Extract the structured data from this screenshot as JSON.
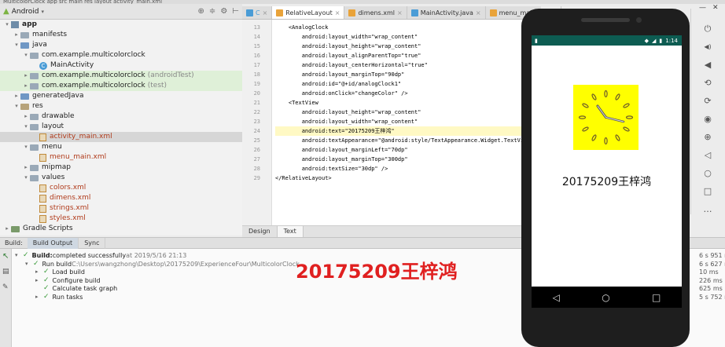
{
  "breadcrumb": "MulticolorClock  app  src  main  res  layout  activity_main.xml",
  "project": {
    "view_selector": "Android",
    "tree": [
      {
        "label": "app",
        "kind": "app",
        "arrow": "▾",
        "indent": 0
      },
      {
        "label": "manifests",
        "kind": "folder",
        "arrow": "▸",
        "indent": 1
      },
      {
        "label": "java",
        "kind": "folder-java",
        "arrow": "▾",
        "indent": 1
      },
      {
        "label": "com.example.multicolorclock",
        "kind": "folder",
        "arrow": "▾",
        "indent": 2
      },
      {
        "label": "MainActivity",
        "kind": "class",
        "arrow": "",
        "indent": 3
      },
      {
        "label": "com.example.multicolorclock",
        "sub": "(androidTest)",
        "kind": "folder",
        "arrow": "▸",
        "indent": 2,
        "highlight": true
      },
      {
        "label": "com.example.multicolorclock",
        "sub": "(test)",
        "kind": "folder",
        "arrow": "▸",
        "indent": 2,
        "highlight": true
      },
      {
        "label": "generatedJava",
        "kind": "folder-java",
        "arrow": "▸",
        "indent": 1
      },
      {
        "label": "res",
        "kind": "folder-res",
        "arrow": "▾",
        "indent": 1
      },
      {
        "label": "drawable",
        "kind": "folder",
        "arrow": "▸",
        "indent": 2
      },
      {
        "label": "layout",
        "kind": "folder",
        "arrow": "▾",
        "indent": 2
      },
      {
        "label": "activity_main.xml",
        "kind": "xml",
        "arrow": "",
        "indent": 3,
        "selected": true
      },
      {
        "label": "menu",
        "kind": "folder",
        "arrow": "▾",
        "indent": 2
      },
      {
        "label": "menu_main.xml",
        "kind": "xml",
        "arrow": "",
        "indent": 3
      },
      {
        "label": "mipmap",
        "kind": "folder",
        "arrow": "▸",
        "indent": 2
      },
      {
        "label": "values",
        "kind": "folder",
        "arrow": "▾",
        "indent": 2
      },
      {
        "label": "colors.xml",
        "kind": "xml",
        "arrow": "",
        "indent": 3
      },
      {
        "label": "dimens.xml",
        "kind": "xml",
        "arrow": "",
        "indent": 3
      },
      {
        "label": "strings.xml",
        "kind": "xml",
        "arrow": "",
        "indent": 3
      },
      {
        "label": "styles.xml",
        "kind": "xml",
        "arrow": "",
        "indent": 3
      },
      {
        "label": "Gradle Scripts",
        "kind": "gradle",
        "arrow": "▸",
        "indent": 0
      }
    ]
  },
  "editor": {
    "tabs": [
      {
        "label": "C",
        "kind": "class",
        "active": false
      },
      {
        "label": "RelativeLayout",
        "kind": "xml",
        "active": true
      },
      {
        "label": "dimens.xml",
        "kind": "xml",
        "active": false
      },
      {
        "label": "MainActivity.java",
        "kind": "class",
        "active": false
      },
      {
        "label": "menu_main.xml",
        "kind": "xml",
        "active": false
      }
    ],
    "lines": [
      {
        "n": "13",
        "text": "    <AnalogClock",
        "hl": false
      },
      {
        "n": "14",
        "text": "        android:layout_width=\"wrap_content\"",
        "hl": false
      },
      {
        "n": "15",
        "text": "        android:layout_height=\"wrap_content\"",
        "hl": false
      },
      {
        "n": "16",
        "text": "        android:layout_alignParentTop=\"true\"",
        "hl": false
      },
      {
        "n": "17",
        "text": "        android:layout_centerHorizontal=\"true\"",
        "hl": false
      },
      {
        "n": "18",
        "text": "        android:layout_marginTop=\"90dp\"",
        "hl": false
      },
      {
        "n": "19",
        "text": "        android:id=\"@+id/analogClock1\"",
        "hl": false
      },
      {
        "n": "20",
        "text": "        android:onClick=\"changeColor\" />",
        "hl": false
      },
      {
        "n": "21",
        "text": "    <TextView",
        "hl": false
      },
      {
        "n": "22",
        "text": "        android:layout_height=\"wrap_content\"",
        "hl": false
      },
      {
        "n": "23",
        "text": "        android:layout_width=\"wrap_content\"",
        "hl": false
      },
      {
        "n": "24",
        "text": "        android:text=\"20175209王梓鸿\"",
        "hl": true
      },
      {
        "n": "25",
        "text": "        android:textAppearance=\"@android:style/TextAppearance.Widget.TextView\"",
        "hl": false
      },
      {
        "n": "26",
        "text": "        android:layout_marginLeft=\"70dp\"",
        "hl": false
      },
      {
        "n": "27",
        "text": "        android:layout_marginTop=\"300dp\"",
        "hl": false
      },
      {
        "n": "28",
        "text": "        android:textSize=\"30dp\" />",
        "hl": false
      },
      {
        "n": "29",
        "text": "</RelativeLayout>",
        "hl": false
      }
    ],
    "bottom_tabs": [
      {
        "label": "Design",
        "active": false
      },
      {
        "label": "Text",
        "active": true
      }
    ]
  },
  "build": {
    "header_label": "Build:",
    "tabs": [
      {
        "label": "Build Output",
        "active": true
      },
      {
        "label": "Sync",
        "active": false
      }
    ],
    "rows": [
      {
        "label": "Build:",
        "rest": " completed successfully",
        "dim": " at 2019/5/16 21:13",
        "time": "6 s 951 ms",
        "indent": 0,
        "arrow": "▾"
      },
      {
        "label": "Run build",
        "rest": "",
        "dim": " C:\\Users\\wangzhong\\Desktop\\20175209\\ExperienceFour\\MulticolorClock",
        "time": "6 s 627 ms",
        "indent": 1,
        "arrow": "▾"
      },
      {
        "label": "Load build",
        "rest": "",
        "dim": "",
        "time": "10 ms",
        "indent": 2,
        "arrow": "▸"
      },
      {
        "label": "Configure build",
        "rest": "",
        "dim": "",
        "time": "226 ms",
        "indent": 2,
        "arrow": "▸"
      },
      {
        "label": "Calculate task graph",
        "rest": "",
        "dim": "",
        "time": "625 ms",
        "indent": 2,
        "arrow": ""
      },
      {
        "label": "Run tasks",
        "rest": "",
        "dim": "",
        "time": "5 s 752 ms",
        "indent": 2,
        "arrow": "▸"
      }
    ],
    "overlay_text": "20175209王梓鸿"
  },
  "phone": {
    "status_time": "1:14",
    "screen_text": "20175209王梓鸿",
    "clock_color": "#ffff00",
    "status_bar_color": "#0d5c52"
  },
  "emulator_controls": [
    "power-icon",
    "volume-up-icon",
    "volume-down-icon",
    "rotate-left-icon",
    "rotate-right-icon",
    "camera-icon",
    "zoom-in-icon",
    "back-icon",
    "home-icon",
    "overview-icon",
    "more-icon"
  ]
}
